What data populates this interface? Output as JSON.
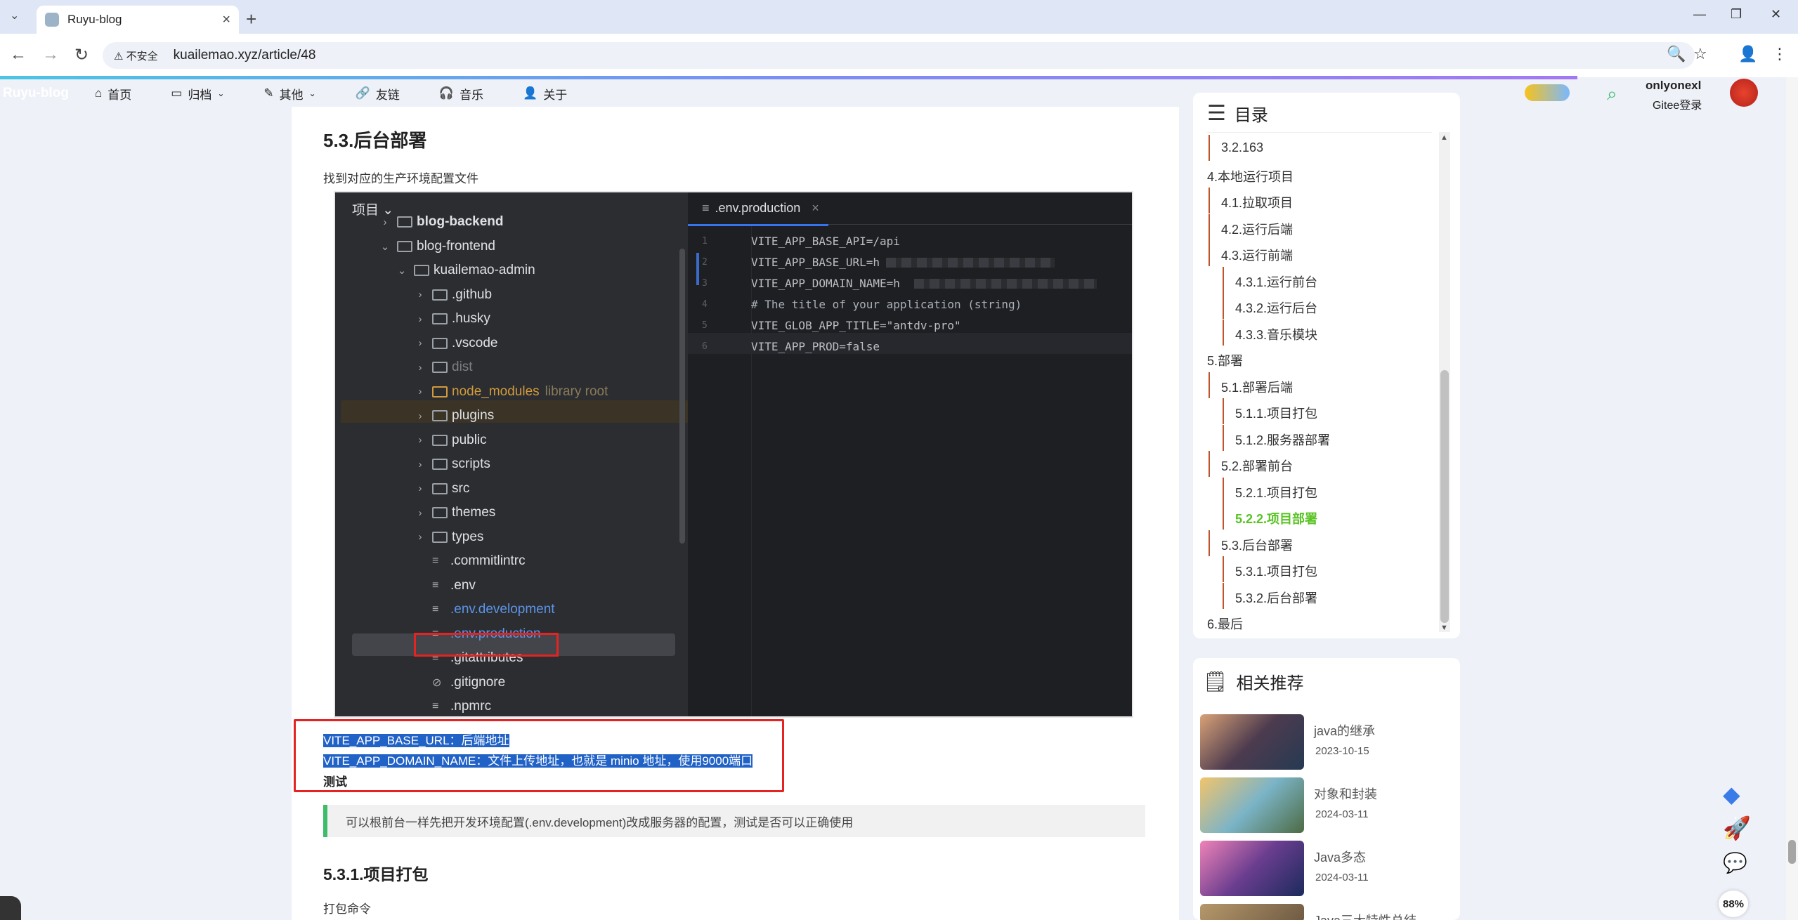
{
  "browser": {
    "tab_title": "Ruyu-blog",
    "security_label": "不安全",
    "url": "kuailemao.xyz/article/48",
    "zoom": "88%"
  },
  "site": {
    "logo": "Ruyu-blog",
    "nav": [
      {
        "label": "首页",
        "icon": "home-icon"
      },
      {
        "label": "归档",
        "icon": "archive-icon",
        "dropdown": true
      },
      {
        "label": "其他",
        "icon": "pen-icon",
        "dropdown": true
      },
      {
        "label": "友链",
        "icon": "link-icon"
      },
      {
        "label": "音乐",
        "icon": "headphones-icon"
      },
      {
        "label": "关于",
        "icon": "user-icon"
      }
    ],
    "user": {
      "name": "onlyonexl",
      "login": "Gitee登录"
    }
  },
  "article": {
    "heading_1": "5.3.后台部署",
    "intro": "找到对应的生产环境配置文件",
    "selected_line_1": "VITE_APP_BASE_URL：后端地址",
    "selected_line_2": "VITE_APP_DOMAIN_NAME：文件上传地址，也就是 minio 地址，使用9000端口",
    "bold_line": "测试",
    "quote": "可以根前台一样先把开发环境配置(.env.development)改成服务器的配置，测试是否可以正确使用",
    "heading_2": "5.3.1.项目打包",
    "pack_cmd": "打包命令"
  },
  "ide": {
    "panel_title": "项目",
    "tab_file": ".env.production",
    "tree": [
      {
        "name": "blog-backend",
        "type": "folder",
        "bold": true
      },
      {
        "name": "blog-frontend",
        "type": "folder",
        "open": true
      },
      {
        "name": "kuailemao-admin",
        "type": "folder",
        "open": true
      },
      {
        "name": ".github",
        "type": "folder"
      },
      {
        "name": ".husky",
        "type": "folder"
      },
      {
        "name": ".vscode",
        "type": "folder"
      },
      {
        "name": "dist",
        "type": "folder",
        "muted": true
      },
      {
        "name": "node_modules",
        "type": "folder",
        "suffix": "library root",
        "highlight": true
      },
      {
        "name": "plugins",
        "type": "folder"
      },
      {
        "name": "public",
        "type": "folder"
      },
      {
        "name": "scripts",
        "type": "folder"
      },
      {
        "name": "src",
        "type": "folder"
      },
      {
        "name": "themes",
        "type": "folder"
      },
      {
        "name": "types",
        "type": "folder"
      },
      {
        "name": ".commitlintrc",
        "type": "file"
      },
      {
        "name": ".env",
        "type": "file"
      },
      {
        "name": ".env.development",
        "type": "file",
        "blue": true
      },
      {
        "name": ".env.production",
        "type": "file",
        "blue": true,
        "selected": true
      },
      {
        "name": ".gitattributes",
        "type": "file"
      },
      {
        "name": ".gitignore",
        "type": "file"
      },
      {
        "name": ".npmrc",
        "type": "file"
      }
    ],
    "code": [
      {
        "n": "1",
        "text": "VITE_APP_BASE_API=/api"
      },
      {
        "n": "2",
        "text": "VITE_APP_BASE_URL=h"
      },
      {
        "n": "3",
        "text": "VITE_APP_DOMAIN_NAME=h"
      },
      {
        "n": "4",
        "text": "# The title of your application (string)"
      },
      {
        "n": "5",
        "text": "VITE_GLOB_APP_TITLE=\"antdv-pro\""
      },
      {
        "n": "6",
        "text": "VITE_APP_PROD=false"
      }
    ]
  },
  "toc": {
    "title": "目录",
    "items": [
      {
        "label": "3.2.163",
        "level": 2
      },
      {
        "label": "4.本地运行项目",
        "level": 1
      },
      {
        "label": "4.1.拉取项目",
        "level": 2
      },
      {
        "label": "4.2.运行后端",
        "level": 2
      },
      {
        "label": "4.3.运行前端",
        "level": 2
      },
      {
        "label": "4.3.1.运行前台",
        "level": 3
      },
      {
        "label": "4.3.2.运行后台",
        "level": 3
      },
      {
        "label": "4.3.3.音乐模块",
        "level": 3
      },
      {
        "label": "5.部署",
        "level": 1
      },
      {
        "label": "5.1.部署后端",
        "level": 2
      },
      {
        "label": "5.1.1.项目打包",
        "level": 3
      },
      {
        "label": "5.1.2.服务器部署",
        "level": 3
      },
      {
        "label": "5.2.部署前台",
        "level": 2
      },
      {
        "label": "5.2.1.项目打包",
        "level": 3
      },
      {
        "label": "5.2.2.项目部署",
        "level": 3,
        "active": true
      },
      {
        "label": "5.3.后台部署",
        "level": 2
      },
      {
        "label": "5.3.1.项目打包",
        "level": 3
      },
      {
        "label": "5.3.2.后台部署",
        "level": 3
      },
      {
        "label": "6.最后",
        "level": 1
      }
    ]
  },
  "related": {
    "title": "相关推荐",
    "items": [
      {
        "title": "java的继承",
        "date": "2023-10-15"
      },
      {
        "title": "对象和封装",
        "date": "2024-03-11"
      },
      {
        "title": "Java多态",
        "date": "2024-03-11"
      },
      {
        "title": "Java三大特性总结",
        "date": ""
      }
    ]
  },
  "colors": {
    "accent": "#58c322",
    "selection": "#2162c6",
    "red_box": "#e52323",
    "quote_border": "#3ebd69"
  }
}
